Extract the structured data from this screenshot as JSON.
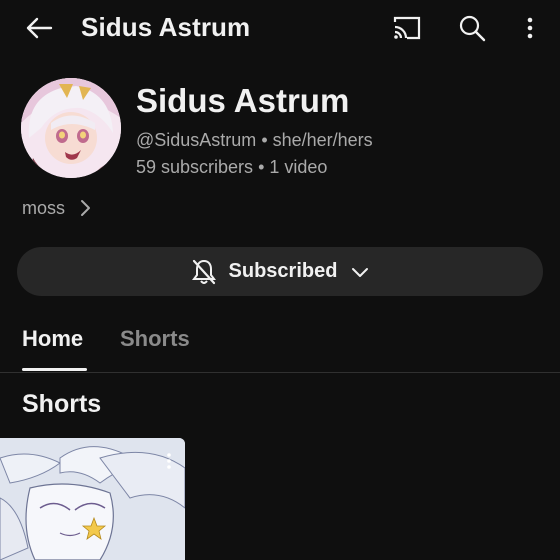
{
  "header": {
    "title": "Sidus Astrum",
    "icons": [
      "back-arrow-icon",
      "cast-icon",
      "search-icon",
      "more-vert-icon"
    ]
  },
  "channel": {
    "name": "Sidus Astrum",
    "handle": "@SidusAstrum",
    "pronouns": "she/her/hers",
    "subscribers": "59 subscribers",
    "videos": "1 video",
    "separator": "•",
    "description": "moss"
  },
  "subscribe": {
    "label": "Subscribed",
    "icon": "bell-off-icon"
  },
  "tabs": [
    {
      "label": "Home",
      "active": true
    },
    {
      "label": "Shorts",
      "active": false
    }
  ],
  "sections": {
    "shorts_title": "Shorts"
  },
  "colors": {
    "background": "#0f0f0f",
    "text_primary": "#f1f1f1",
    "text_secondary": "#aaaaaa",
    "button_bg": "#272727"
  }
}
